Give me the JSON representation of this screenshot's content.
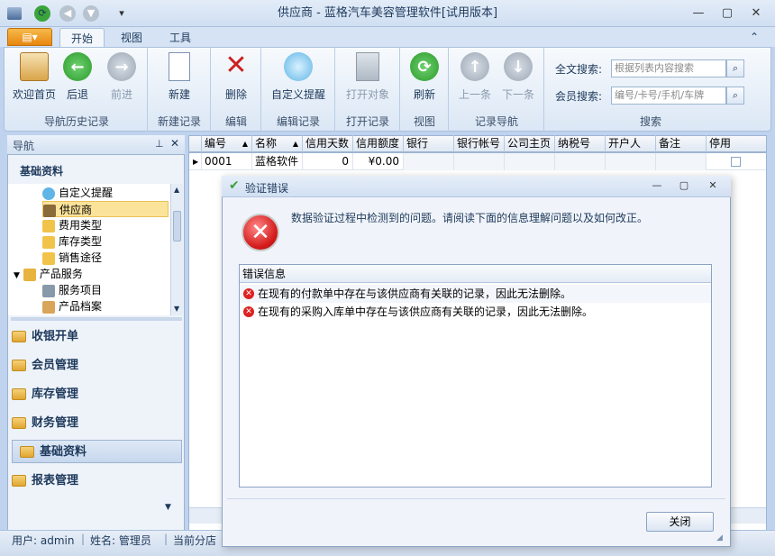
{
  "window": {
    "title": "供应商 - 蓝格汽车美容管理软件[试用版本]"
  },
  "tabs": [
    "开始",
    "视图",
    "工具"
  ],
  "ribbon": {
    "groups": [
      {
        "label": "导航历史记录",
        "buttons": [
          "欢迎首页",
          "后退",
          "前进"
        ]
      },
      {
        "label": "新建记录",
        "buttons": [
          "新建"
        ]
      },
      {
        "label": "编辑",
        "buttons": [
          "删除"
        ]
      },
      {
        "label": "编辑记录",
        "buttons": [
          "自定义提醒"
        ]
      },
      {
        "label": "打开记录",
        "buttons": [
          "打开对象"
        ]
      },
      {
        "label": "视图",
        "buttons": [
          "刷新"
        ]
      },
      {
        "label": "记录导航",
        "buttons": [
          "上一条",
          "下一条"
        ]
      },
      {
        "label": "搜索",
        "buttons": []
      }
    ],
    "search": {
      "fulltext_label": "全文搜索:",
      "fulltext_placeholder": "根据列表内容搜索",
      "member_label": "会员搜索:",
      "member_placeholder": "编号/卡号/手机/车牌"
    }
  },
  "nav": {
    "title": "导航",
    "section": "基础资料",
    "items": [
      "自定义提醒",
      "供应商",
      "费用类型",
      "库存类型",
      "销售途径",
      "产品服务",
      "服务项目",
      "产品档案"
    ],
    "selected": "供应商",
    "groups": [
      "收银开单",
      "会员管理",
      "库存管理",
      "财务管理",
      "基础资料",
      "报表管理"
    ],
    "active_group": "基础资料"
  },
  "grid": {
    "columns": [
      "编号",
      "名称",
      "信用天数",
      "信用额度",
      "银行",
      "银行帐号",
      "公司主页",
      "纳税号",
      "开户人",
      "备注",
      "停用"
    ],
    "rows": [
      [
        "0001",
        "蓝格软件",
        "0",
        "¥0.00",
        "",
        "",
        "",
        "",
        "",
        "",
        ""
      ]
    ]
  },
  "dialog": {
    "title": "验证错误",
    "message": "数据验证过程中检测到的问题。请阅读下面的信息理解问题以及如何改正。",
    "panel_header": "错误信息",
    "errors": [
      "在现有的付款单中存在与该供应商有关联的记录，因此无法删除。",
      "在现有的采购入库单中存在与该供应商有关联的记录，因此无法删除。"
    ],
    "close_label": "关闭"
  },
  "status": {
    "user": "用户: admin",
    "name": "姓名: 管理员",
    "branch": "当前分店"
  },
  "colors": {
    "accent": "#e8870f",
    "error": "#dd2222",
    "selection": "#fbe39a"
  }
}
